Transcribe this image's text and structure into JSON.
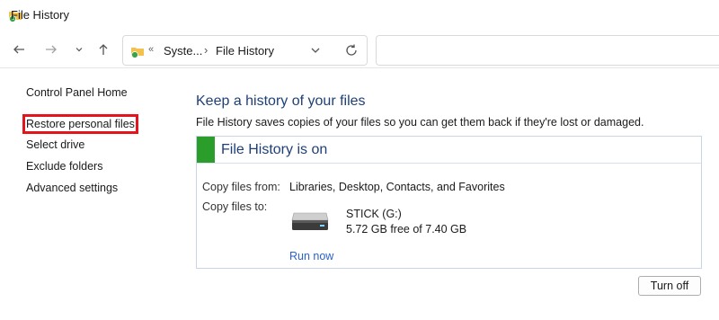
{
  "window": {
    "title": "File History"
  },
  "nav": {
    "back_icon": "arrow-left-icon",
    "forward_icon": "arrow-right-icon",
    "recent_icon": "chevron-down-icon",
    "up_icon": "arrow-up-icon"
  },
  "address": {
    "overflow": "«",
    "crumbs": [
      "Syste...",
      "File History"
    ],
    "separator": "›"
  },
  "sidebar": {
    "items": [
      {
        "label": "Control Panel Home"
      },
      {
        "label": "Restore personal files"
      },
      {
        "label": "Select drive"
      },
      {
        "label": "Exclude folders"
      },
      {
        "label": "Advanced settings"
      }
    ]
  },
  "main": {
    "heading": "Keep a history of your files",
    "description": "File History saves copies of your files so you can get them back if they're lost or damaged."
  },
  "panel": {
    "status": "File History is on",
    "status_color": "#2a9d2a",
    "copy_from_label": "Copy files from:",
    "copy_from_value": "Libraries, Desktop, Contacts, and Favorites",
    "copy_to_label": "Copy files to:",
    "drive_name": "STICK (G:)",
    "drive_free": "5.72 GB free of 7.40 GB",
    "run_now": "Run now"
  },
  "buttons": {
    "turn_off": "Turn off"
  },
  "colors": {
    "accent_heading": "#1e3f78",
    "link": "#2b62c8",
    "highlight_box": "#e3141c"
  }
}
